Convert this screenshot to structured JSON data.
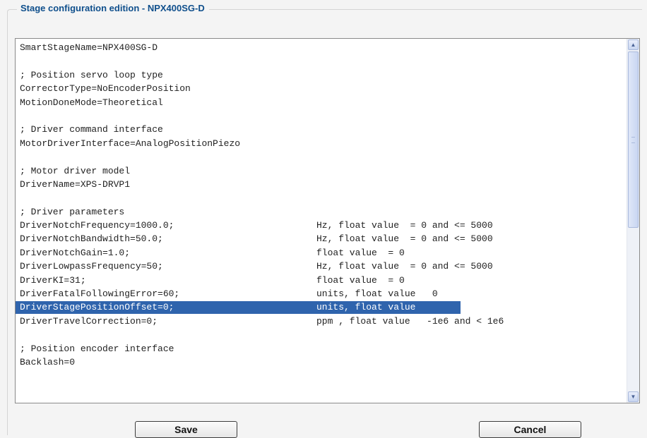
{
  "dialog": {
    "title": "Stage configuration edition - NPX400SG-D"
  },
  "editor": {
    "lines": [
      {
        "key": "SmartStageName=NPX400SG-D",
        "note": ""
      },
      {
        "key": "",
        "note": ""
      },
      {
        "key": "; Position servo loop type",
        "note": ""
      },
      {
        "key": "CorrectorType=NoEncoderPosition",
        "note": ""
      },
      {
        "key": "MotionDoneMode=Theoretical",
        "note": ""
      },
      {
        "key": "",
        "note": ""
      },
      {
        "key": "; Driver command interface",
        "note": ""
      },
      {
        "key": "MotorDriverInterface=AnalogPositionPiezo",
        "note": ""
      },
      {
        "key": "",
        "note": ""
      },
      {
        "key": "; Motor driver model",
        "note": ""
      },
      {
        "key": "DriverName=XPS-DRVP1",
        "note": ""
      },
      {
        "key": "",
        "note": ""
      },
      {
        "key": "; Driver parameters",
        "note": ""
      },
      {
        "key": "DriverNotchFrequency=1000.0;",
        "note": "Hz, float value  = 0 and <= 5000"
      },
      {
        "key": "DriverNotchBandwidth=50.0;",
        "note": "Hz, float value  = 0 and <= 5000"
      },
      {
        "key": "DriverNotchGain=1.0;",
        "note": "float value  = 0"
      },
      {
        "key": "DriverLowpassFrequency=50;",
        "note": "Hz, float value  = 0 and <= 5000"
      },
      {
        "key": "DriverKI=31;",
        "note": "float value  = 0"
      },
      {
        "key": "DriverFatalFollowingError=60;",
        "note": "units, float value   0"
      },
      {
        "key": "DriverStagePositionOffset=0;",
        "note": "units, float value"
      },
      {
        "key": "DriverTravelCorrection=0;",
        "note": "ppm , float value   -1e6 and < 1e6"
      },
      {
        "key": "",
        "note": ""
      },
      {
        "key": "; Position encoder interface",
        "note": ""
      },
      {
        "key": "Backlash=0",
        "note": ""
      }
    ],
    "selected_line": "DriverStagePositionOffset=0;",
    "scroll": {
      "position_fraction": 0.0,
      "visible_fraction": 0.5
    }
  },
  "buttons": {
    "save_label": "Save",
    "cancel_label": "Cancel"
  },
  "icons": {
    "scroll_up": "chevron-up-icon",
    "scroll_down": "chevron-down-icon"
  },
  "colors": {
    "title": "#0f4f8c",
    "selection": "#2f64ad",
    "background": "#f4f4f4"
  }
}
